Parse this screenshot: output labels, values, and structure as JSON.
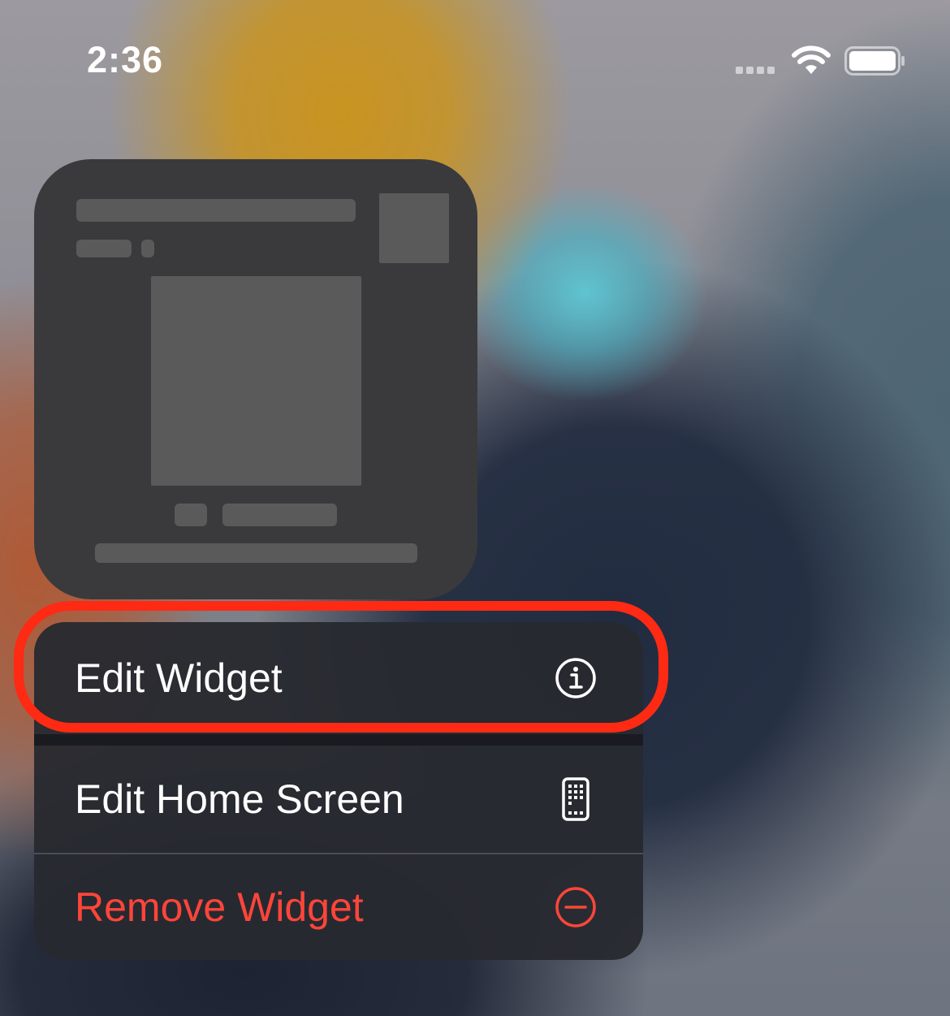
{
  "status_bar": {
    "time": "2:36",
    "signal_icon": "cellular-signal-icon",
    "wifi_icon": "wifi-icon",
    "battery_icon": "battery-icon"
  },
  "widget": {
    "state": "placeholder"
  },
  "context_menu": {
    "items": [
      {
        "label": "Edit Widget",
        "icon": "info-circle-icon",
        "highlighted": true
      },
      {
        "label": "Edit Home Screen",
        "icon": "phone-apps-icon"
      },
      {
        "label": "Remove Widget",
        "icon": "minus-circle-icon",
        "destructive": true
      }
    ]
  },
  "colors": {
    "highlight": "#ff2a14",
    "destructive": "#ff453a",
    "menu_background": "#28292f",
    "widget_background": "#3a3a3c",
    "placeholder": "#5a5a5a"
  }
}
